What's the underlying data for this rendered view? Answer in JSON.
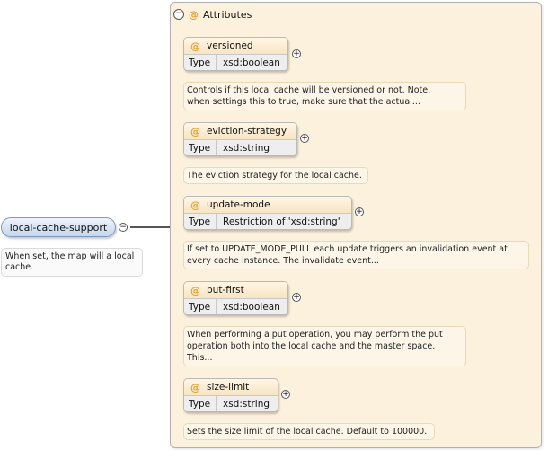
{
  "element": {
    "name": "local-cache-support",
    "doc": [
      "When set, the map will a local",
      "cache."
    ],
    "collapse_glyph": "−"
  },
  "attributes_group": {
    "title": "Attributes",
    "collapse_glyph": "−",
    "at_symbol": "@",
    "type_key": "Type",
    "expand_glyph": "+"
  },
  "attributes": [
    {
      "name": "versioned",
      "type": "xsd:boolean",
      "doc": [
        "Controls if this local cache will be versioned or not. Note,",
        "when settings this to true, make sure that the actual..."
      ]
    },
    {
      "name": "eviction-strategy",
      "type": "xsd:string",
      "doc": [
        "The eviction strategy for the local cache."
      ]
    },
    {
      "name": "update-mode",
      "type": "Restriction of 'xsd:string'",
      "doc": [
        "If set to UPDATE_MODE_PULL each update triggers an invalidation event at",
        "every cache instance. The invalidate event..."
      ]
    },
    {
      "name": "put-first",
      "type": "xsd:boolean",
      "doc": [
        "When performing a put operation, you may perform the put",
        "operation both into the local cache and the master space.",
        "This..."
      ]
    },
    {
      "name": "size-limit",
      "type": "xsd:string",
      "doc": [
        "Sets the size limit of the local cache. Default to 100000."
      ]
    }
  ]
}
